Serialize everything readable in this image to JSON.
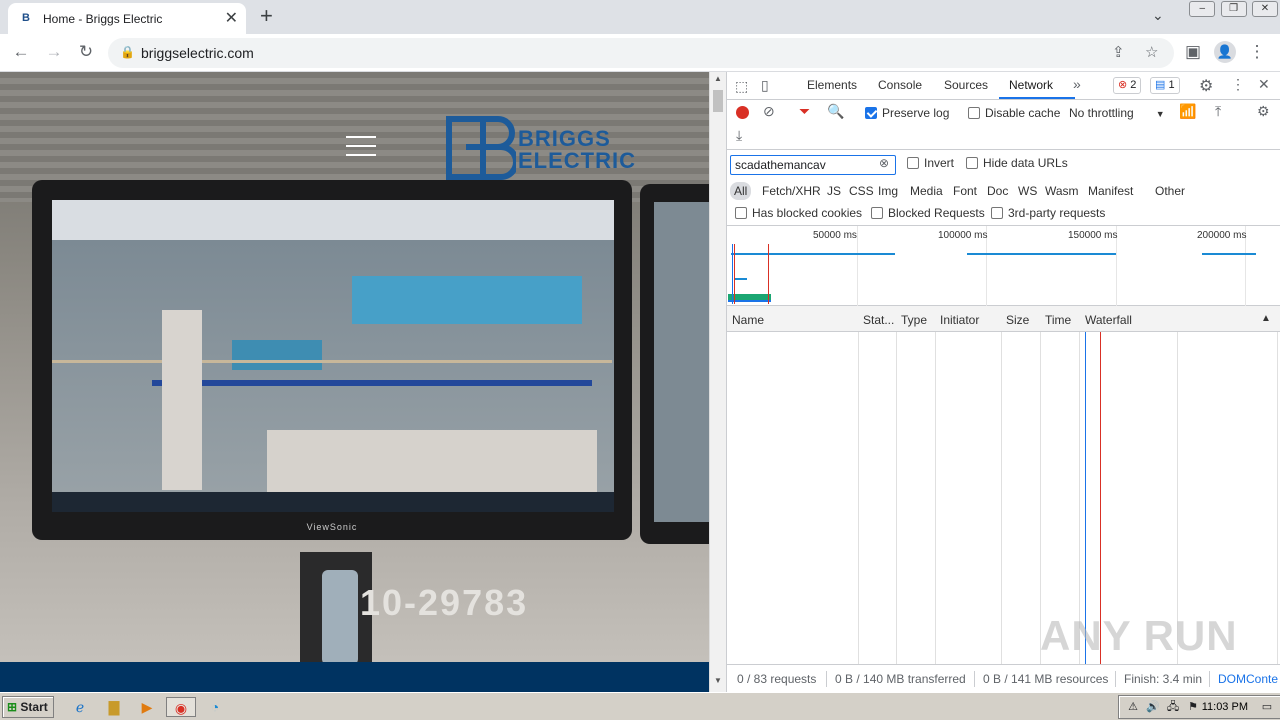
{
  "browser": {
    "tab_title": "Home - Briggs Electric",
    "tab_favicon": "B",
    "url": "briggselectric.com",
    "window_controls": [
      "–",
      "❐",
      "✕"
    ]
  },
  "site": {
    "logo_line1": "BRIGGS",
    "logo_line2": "ELECTRIC",
    "monitor_brand": "ViewSonic",
    "phone_partial": "10-29783",
    "brand_color": "#1d5b9a",
    "footer_color": "#003361"
  },
  "devtools": {
    "tabs": [
      "Elements",
      "Console",
      "Sources",
      "Network"
    ],
    "active_tab": "Network",
    "errors_count": "2",
    "messages_count": "1",
    "preserve_log": "Preserve log",
    "disable_cache": "Disable cache",
    "throttling": "No throttling",
    "filter_value": "scadathemancav",
    "invert": "Invert",
    "hide_data_urls": "Hide data URLs",
    "types": [
      "All",
      "Fetch/XHR",
      "JS",
      "CSS",
      "Img",
      "Media",
      "Font",
      "Doc",
      "WS",
      "Wasm",
      "Manifest",
      "Other"
    ],
    "has_blocked_cookies": "Has blocked cookies",
    "blocked_requests": "Blocked Requests",
    "third_party": "3rd-party requests",
    "ticks": [
      "50000 ms",
      "100000 ms",
      "150000 ms",
      "200000 ms"
    ],
    "columns": [
      "Name",
      "Stat...",
      "Type",
      "Initiator",
      "Size",
      "Time",
      "Waterfall"
    ],
    "status": {
      "requests": "0 / 83 requests",
      "transferred": "0 B / 140 MB transferred",
      "resources": "0 B / 141 MB resources",
      "finish": "Finish: 3.4 min",
      "domcontent": "DOMConte"
    }
  },
  "watermark": "ANY RUN",
  "taskbar": {
    "start": "Start",
    "clock": "11:03 PM"
  }
}
